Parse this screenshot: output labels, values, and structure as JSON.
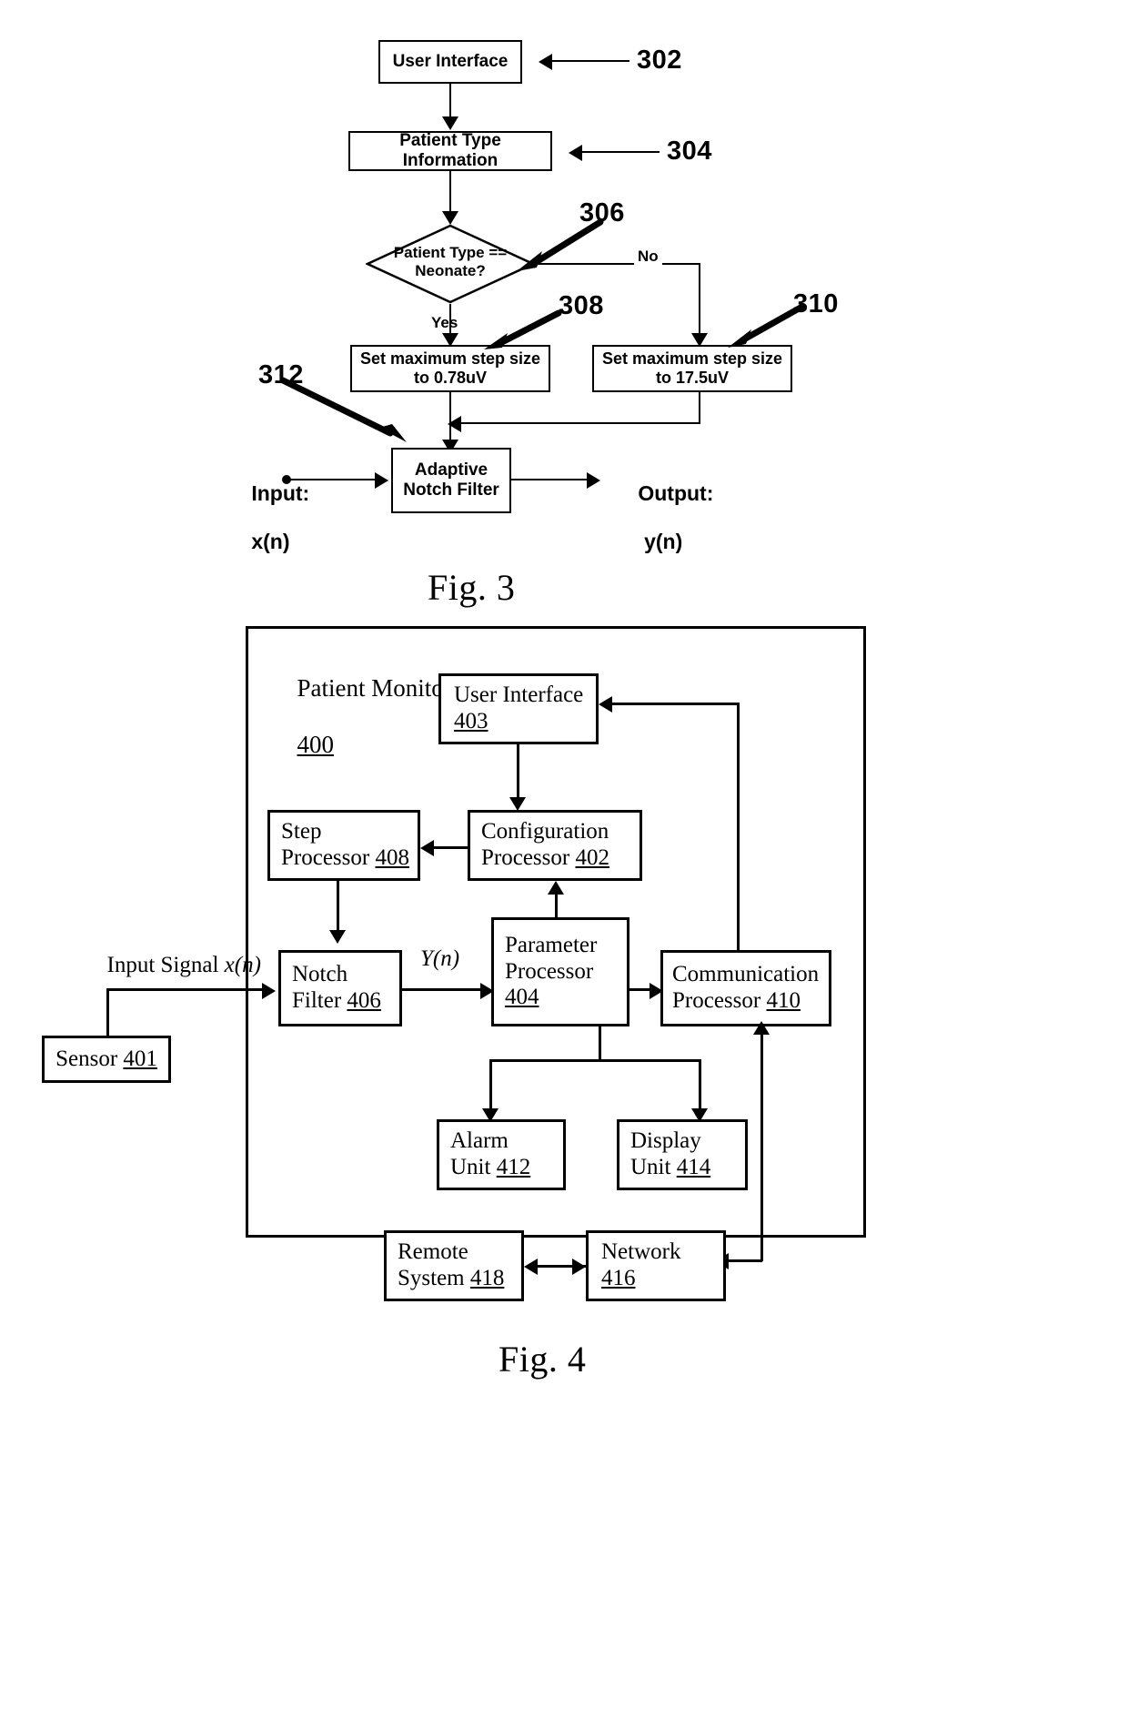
{
  "document": {
    "type": "patent-figure-sheet",
    "figures": [
      "Fig. 3",
      "Fig. 4"
    ]
  },
  "fig3": {
    "caption": "Fig. 3",
    "nodes": {
      "user_interface": "User Interface",
      "patient_type_information": "Patient Type Information",
      "decision_line1": "Patient Type ==",
      "decision_line2": "Neonate?",
      "set_step_neonate_line1": "Set maximum step size",
      "set_step_neonate_line2": "to 0.78uV",
      "set_step_other_line1": "Set maximum step size",
      "set_step_other_line2": "to 17.5uV",
      "adaptive_notch_filter_line1": "Adaptive",
      "adaptive_notch_filter_line2": "Notch Filter"
    },
    "edge_labels": {
      "yes": "Yes",
      "no": "No"
    },
    "io_labels": {
      "input_line1": "Input:",
      "input_line2": "x(n)",
      "output_line1": "Output:",
      "output_line2": "y(n)"
    },
    "reference_numerals": {
      "user_interface": "302",
      "patient_type_information": "304",
      "decision": "306",
      "set_step_neonate": "308",
      "set_step_other": "310",
      "adaptive_notch_filter": "312"
    }
  },
  "fig4": {
    "caption": "Fig. 4",
    "container": {
      "title": "Patient Monitor",
      "ref": "400"
    },
    "blocks": [
      {
        "key": "user_interface",
        "line1": "User Interface",
        "ref": "403",
        "ref_inline": false
      },
      {
        "key": "step_processor",
        "line1": "Step",
        "line2": "Processor ",
        "ref": "408",
        "ref_inline": true
      },
      {
        "key": "configuration_processor",
        "line1": "Configuration",
        "line2": "Processor ",
        "ref": "402",
        "ref_inline": true
      },
      {
        "key": "notch_filter",
        "line1": "Notch",
        "line2": "Filter ",
        "ref": "406",
        "ref_inline": true
      },
      {
        "key": "parameter_processor",
        "line1": "Parameter",
        "line2": "Processor",
        "ref": "404",
        "ref_inline": false
      },
      {
        "key": "communication_processor",
        "line1": "Communication",
        "line2": "Processor ",
        "ref": "410",
        "ref_inline": true
      },
      {
        "key": "alarm_unit",
        "line1": "Alarm",
        "line2": "Unit ",
        "ref": "412",
        "ref_inline": true
      },
      {
        "key": "display_unit",
        "line1": "Display",
        "line2": "Unit ",
        "ref": "414",
        "ref_inline": true
      },
      {
        "key": "sensor",
        "line1": "Sensor ",
        "ref": "401",
        "ref_inline": true
      },
      {
        "key": "remote_system",
        "line1": "Remote",
        "line2": "System ",
        "ref": "418",
        "ref_inline": true
      },
      {
        "key": "network",
        "line1": "Network",
        "ref": "416",
        "ref_inline": false
      }
    ],
    "signal_labels": {
      "input_signal": "Input Signal ",
      "input_signal_var": "x(n)",
      "filter_output": "Y(n)"
    }
  },
  "colors": {
    "ink": "#000000",
    "paper": "#ffffff"
  }
}
